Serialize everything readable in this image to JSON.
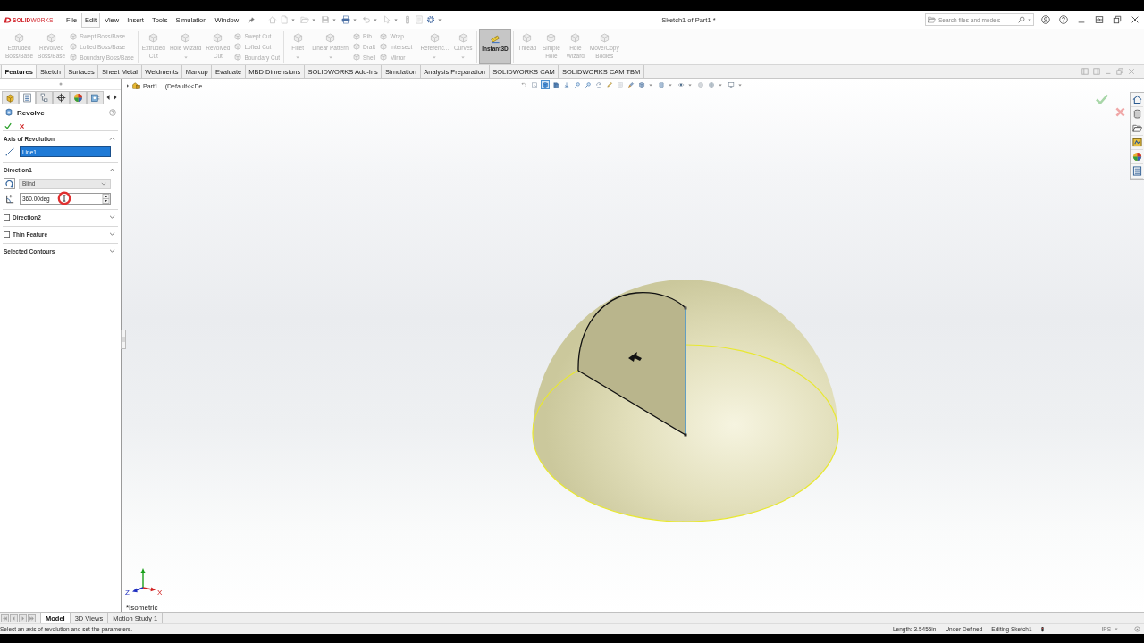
{
  "window": {
    "app_name": "**SOLID**WORKS",
    "title": "Sketch1 of Part1 *"
  },
  "menu": [
    {
      "label": "File",
      "selected": false
    },
    {
      "label": "Edit",
      "selected": true
    },
    {
      "label": "View",
      "selected": false
    },
    {
      "label": "Insert",
      "selected": false
    },
    {
      "label": "Tools",
      "selected": false
    },
    {
      "label": "Simulation",
      "selected": false
    },
    {
      "label": "Window",
      "selected": false
    }
  ],
  "quick_access": [
    {
      "kind": "home",
      "disabled": true,
      "dropdown": false
    },
    {
      "kind": "new",
      "disabled": true,
      "dropdown": true
    },
    {
      "kind": "open",
      "disabled": true,
      "dropdown": true
    },
    {
      "kind": "save",
      "disabled": true,
      "dropdown": true
    },
    {
      "kind": "print",
      "disabled": false,
      "dropdown": true
    },
    {
      "kind": "undo",
      "disabled": true,
      "dropdown": true
    },
    {
      "kind": "select",
      "disabled": true,
      "dropdown": true
    },
    {
      "kind": "rebuild",
      "disabled": true,
      "dropdown": false
    },
    {
      "kind": "properties",
      "disabled": true,
      "dropdown": false
    },
    {
      "kind": "options",
      "disabled": false,
      "dropdown": true
    }
  ],
  "search": {
    "placeholder": "Search files and models"
  },
  "ribbon": {
    "groups": [
      {
        "items": [
          {
            "kind": "large",
            "lines": [
              "Extruded",
              "Boss/Base"
            ],
            "disabled": true,
            "selected": false,
            "dropdown": false
          },
          {
            "kind": "large",
            "lines": [
              "Revolved",
              "Boss/Base"
            ],
            "disabled": true,
            "selected": false,
            "dropdown": false
          },
          {
            "kind": "stack",
            "items": [
              {
                "label": "Swept Boss/Base",
                "disabled": true
              },
              {
                "label": "Lofted Boss/Base",
                "disabled": true
              },
              {
                "label": "Boundary Boss/Base",
                "disabled": true
              }
            ]
          }
        ]
      },
      {
        "items": [
          {
            "kind": "large",
            "lines": [
              "Extruded",
              "Cut"
            ],
            "disabled": true,
            "selected": false,
            "dropdown": false
          },
          {
            "kind": "large",
            "lines": [
              "Hole Wizard"
            ],
            "disabled": true,
            "selected": false,
            "dropdown": true
          },
          {
            "kind": "large",
            "lines": [
              "Revolved",
              "Cut"
            ],
            "disabled": true,
            "selected": false,
            "dropdown": false
          },
          {
            "kind": "stack",
            "items": [
              {
                "label": "Swept Cut",
                "disabled": true
              },
              {
                "label": "Lofted Cut",
                "disabled": true
              },
              {
                "label": "Boundary Cut",
                "disabled": true
              }
            ]
          }
        ]
      },
      {
        "items": [
          {
            "kind": "large",
            "lines": [
              "Fillet"
            ],
            "disabled": true,
            "selected": false,
            "dropdown": true
          },
          {
            "kind": "large",
            "lines": [
              "Linear Pattern"
            ],
            "disabled": true,
            "selected": false,
            "dropdown": true
          },
          {
            "kind": "stack",
            "items": [
              {
                "label": "Rib",
                "disabled": true
              },
              {
                "label": "Draft",
                "disabled": true
              },
              {
                "label": "Shell",
                "disabled": true
              }
            ]
          },
          {
            "kind": "stack",
            "items": [
              {
                "label": "Wrap",
                "disabled": true
              },
              {
                "label": "Intersect",
                "disabled": true
              },
              {
                "label": "Mirror",
                "disabled": true
              }
            ]
          }
        ]
      },
      {
        "items": [
          {
            "kind": "large",
            "lines": [
              "Referenc..."
            ],
            "disabled": true,
            "selected": false,
            "dropdown": true
          },
          {
            "kind": "large",
            "lines": [
              "Curves"
            ],
            "disabled": true,
            "selected": false,
            "dropdown": true
          }
        ]
      },
      {
        "items": [
          {
            "kind": "toggle",
            "lines": [
              "Instant3D"
            ],
            "disabled": false,
            "selected": true,
            "dropdown": false
          }
        ]
      },
      {
        "items": [
          {
            "kind": "large",
            "lines": [
              "Thread"
            ],
            "disabled": true,
            "selected": false,
            "dropdown": false
          },
          {
            "kind": "large",
            "lines": [
              "Simple",
              "Hole"
            ],
            "disabled": true,
            "selected": false,
            "dropdown": false
          },
          {
            "kind": "large",
            "lines": [
              "Hole",
              "Wizard"
            ],
            "disabled": true,
            "selected": false,
            "dropdown": false
          },
          {
            "kind": "large",
            "lines": [
              "Move/Copy",
              "Bodies"
            ],
            "disabled": true,
            "selected": false,
            "dropdown": false
          }
        ]
      }
    ]
  },
  "tabs": [
    {
      "label": "Features",
      "selected": true
    },
    {
      "label": "Sketch",
      "selected": false
    },
    {
      "label": "Surfaces",
      "selected": false
    },
    {
      "label": "Sheet Metal",
      "selected": false
    },
    {
      "label": "Weldments",
      "selected": false
    },
    {
      "label": "Markup",
      "selected": false
    },
    {
      "label": "Evaluate",
      "selected": false
    },
    {
      "label": "MBD Dimensions",
      "selected": false
    },
    {
      "label": "SOLIDWORKS Add-Ins",
      "selected": false
    },
    {
      "label": "Simulation",
      "selected": false
    },
    {
      "label": "Analysis Preparation",
      "selected": false
    },
    {
      "label": "SOLIDWORKS CAM",
      "selected": false
    },
    {
      "label": "SOLIDWORKS CAM TBM",
      "selected": false
    }
  ],
  "panel_tabs": [
    {
      "kind": "feature-tree",
      "selected": false
    },
    {
      "kind": "property",
      "selected": true
    },
    {
      "kind": "configuration",
      "selected": false
    },
    {
      "kind": "dimxpert",
      "selected": false
    },
    {
      "kind": "display",
      "selected": false
    },
    {
      "kind": "cam",
      "selected": false
    }
  ],
  "property_manager": {
    "title": "Revolve",
    "sections": [
      {
        "kind": "axis",
        "title": "Axis of Revolution",
        "expanded": true,
        "field_value": "Line1",
        "field_selected": true
      },
      {
        "kind": "direction",
        "title": "Direction1",
        "expanded": true,
        "end_condition": "Blind",
        "angle": "360.00deg"
      },
      {
        "kind": "checkable",
        "title": "Direction2",
        "expanded": false,
        "checked": false
      },
      {
        "kind": "checkable",
        "title": "Thin Feature",
        "expanded": false,
        "checked": false
      },
      {
        "kind": "plain",
        "title": "Selected Contours",
        "expanded": false
      }
    ]
  },
  "feature_tree": {
    "expanded": false,
    "name": "Part1",
    "config": "(Default<<De.."
  },
  "view_toolbar": [
    {
      "kind": "back",
      "selected": false,
      "dropdown": false
    },
    {
      "kind": "frame",
      "selected": false,
      "dropdown": false
    },
    {
      "kind": "cube",
      "selected": true,
      "dropdown": false
    },
    {
      "kind": "halfcube",
      "selected": false,
      "dropdown": false
    },
    {
      "kind": "anchor",
      "selected": false,
      "dropdown": false
    },
    {
      "kind": "zoom",
      "selected": false,
      "dropdown": false
    },
    {
      "kind": "zoom",
      "selected": false,
      "dropdown": false
    },
    {
      "kind": "rotate",
      "selected": false,
      "dropdown": false
    },
    {
      "kind": "pencil",
      "selected": false,
      "dropdown": false
    },
    {
      "kind": "grid",
      "selected": false,
      "dropdown": false
    },
    {
      "kind": "brush",
      "selected": false,
      "dropdown": false
    },
    {
      "kind": "shaded",
      "selected": false,
      "dropdown": true
    },
    {
      "kind": "cylinder",
      "selected": false,
      "dropdown": true
    },
    {
      "kind": "eye",
      "selected": false,
      "dropdown": true
    },
    {
      "kind": "sphere",
      "selected": false,
      "dropdown": false
    },
    {
      "kind": "globe",
      "selected": false,
      "dropdown": true
    },
    {
      "kind": "monitor",
      "selected": false,
      "dropdown": true
    }
  ],
  "triad": {
    "x_label": "X",
    "z_label": "Z"
  },
  "view_name": "*Isometric",
  "sheet_tabs": [
    {
      "label": "Model",
      "selected": true
    },
    {
      "label": "3D Views",
      "selected": false
    },
    {
      "label": "Motion Study 1",
      "selected": false
    }
  ],
  "status_bar": {
    "message": "Select an axis of revolution and set the parameters.",
    "fields": [
      "Length: 3.5455in",
      "Under Defined",
      "Editing Sketch1"
    ],
    "units": "IPS"
  }
}
